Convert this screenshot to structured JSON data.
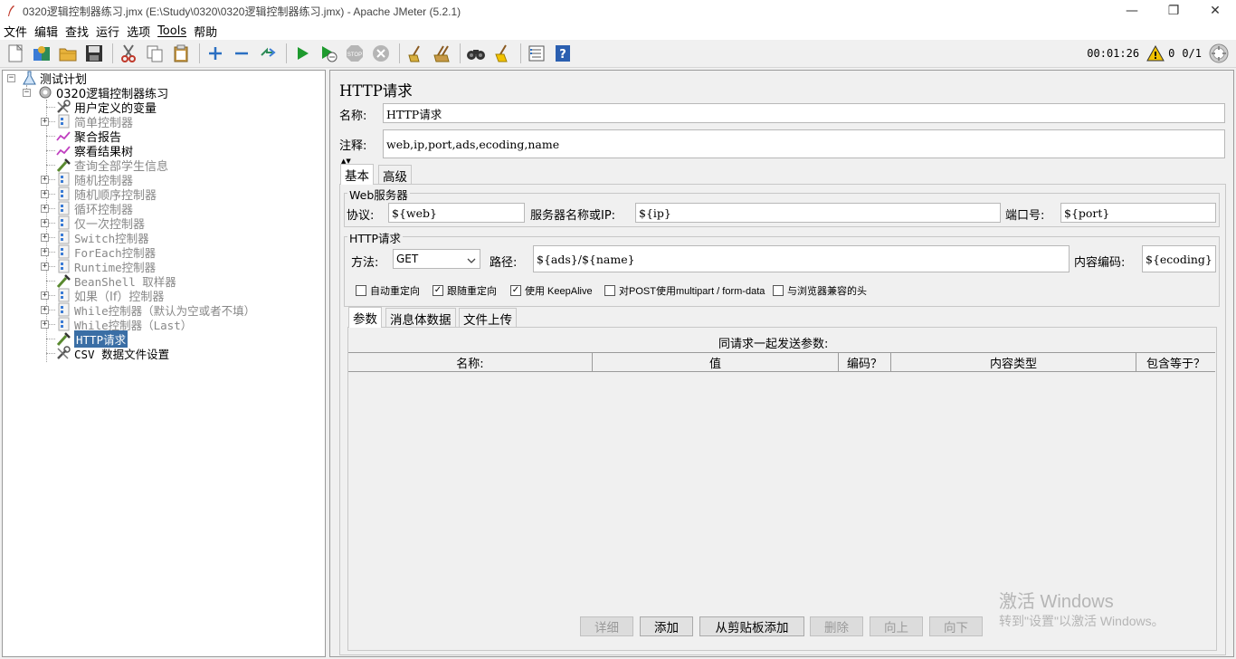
{
  "window": {
    "title": "0320逻辑控制器练习.jmx (E:\\Study\\0320\\0320逻辑控制器练习.jmx) - Apache JMeter (5.2.1)",
    "min_icon": "minimize-icon",
    "max_icon": "restore-icon",
    "close_icon": "close-icon"
  },
  "menu": [
    "文件",
    "编辑",
    "查找",
    "运行",
    "选项",
    "Tools",
    "帮助"
  ],
  "status": {
    "elapsed": "00:01:26",
    "warnings": "0",
    "threads": "0/1"
  },
  "tree": {
    "root": "测试计划",
    "plan": "0320逻辑控制器练习",
    "items": [
      {
        "label": "用户定义的变量",
        "icon": "wrench-icon",
        "expandable": false,
        "mono": false,
        "dim": false,
        "selected": false
      },
      {
        "label": "简单控制器",
        "icon": "controller-icon",
        "expandable": true,
        "mono": false,
        "dim": true,
        "selected": false
      },
      {
        "label": "聚合报告",
        "icon": "graph-icon",
        "expandable": false,
        "mono": false,
        "dim": false,
        "selected": false
      },
      {
        "label": "察看结果树",
        "icon": "graph-icon",
        "expandable": false,
        "mono": false,
        "dim": false,
        "selected": false
      },
      {
        "label": "查询全部学生信息",
        "icon": "pipette-icon",
        "expandable": false,
        "mono": false,
        "dim": true,
        "selected": false
      },
      {
        "label": "随机控制器",
        "icon": "controller-icon",
        "expandable": true,
        "mono": false,
        "dim": true,
        "selected": false
      },
      {
        "label": "随机顺序控制器",
        "icon": "controller-icon",
        "expandable": true,
        "mono": false,
        "dim": true,
        "selected": false
      },
      {
        "label": "循环控制器",
        "icon": "controller-icon",
        "expandable": true,
        "mono": false,
        "dim": true,
        "selected": false
      },
      {
        "label": "仅一次控制器",
        "icon": "controller-icon",
        "expandable": true,
        "mono": false,
        "dim": true,
        "selected": false
      },
      {
        "label": "Switch控制器",
        "icon": "controller-icon",
        "expandable": true,
        "mono": true,
        "dim": true,
        "selected": false
      },
      {
        "label": "ForEach控制器",
        "icon": "controller-icon",
        "expandable": true,
        "mono": true,
        "dim": true,
        "selected": false
      },
      {
        "label": "Runtime控制器",
        "icon": "controller-icon",
        "expandable": true,
        "mono": true,
        "dim": true,
        "selected": false
      },
      {
        "label": "BeanShell 取样器",
        "icon": "pipette-icon",
        "expandable": false,
        "mono": true,
        "dim": true,
        "selected": false
      },
      {
        "label": "如果（If）控制器",
        "icon": "controller-icon",
        "expandable": true,
        "mono": false,
        "dim": true,
        "selected": false
      },
      {
        "label": "While控制器（默认为空或者不填）",
        "icon": "controller-icon",
        "expandable": true,
        "mono": true,
        "dim": true,
        "selected": false
      },
      {
        "label": "While控制器（Last）",
        "icon": "controller-icon",
        "expandable": true,
        "mono": true,
        "dim": true,
        "selected": false
      },
      {
        "label": "HTTP请求",
        "icon": "pipette-icon",
        "expandable": false,
        "mono": true,
        "dim": false,
        "selected": true
      },
      {
        "label": "CSV 数据文件设置",
        "icon": "wrench-icon",
        "expandable": false,
        "mono": true,
        "dim": false,
        "selected": false
      }
    ]
  },
  "panel": {
    "heading": "HTTP请求",
    "name_label": "名称:",
    "name_value": "HTTP请求",
    "comment_label": "注释:",
    "comment_value": "web,ip,port,ads,ecoding,name",
    "tabs": [
      "基本",
      "高级"
    ],
    "web_server": {
      "title": "Web服务器",
      "protocol_label": "协议:",
      "protocol_value": "${web}",
      "server_label": "服务器名称或IP:",
      "server_value": "${ip}",
      "port_label": "端口号:",
      "port_value": "${port}"
    },
    "http_request": {
      "title": "HTTP请求",
      "method_label": "方法:",
      "method_value": "GET",
      "path_label": "路径:",
      "path_value": "${ads}/${name}",
      "encoding_label": "内容编码:",
      "encoding_value": "${ecoding}"
    },
    "checkboxes": [
      {
        "label": "自动重定向",
        "checked": false
      },
      {
        "label": "跟随重定向",
        "checked": true
      },
      {
        "label": "使用 KeepAlive",
        "checked": true
      },
      {
        "label": "对POST使用multipart / form-data",
        "checked": false
      },
      {
        "label": "与浏览器兼容的头",
        "checked": false
      }
    ],
    "inner_tabs": [
      "参数",
      "消息体数据",
      "文件上传"
    ],
    "params_caption": "同请求一起发送参数:",
    "columns": [
      "名称:",
      "值",
      "编码？",
      "内容类型",
      "包含等于？"
    ],
    "buttons": [
      {
        "label": "详细",
        "enabled": false
      },
      {
        "label": "添加",
        "enabled": true
      },
      {
        "label": "从剪贴板添加",
        "enabled": true
      },
      {
        "label": "删除",
        "enabled": false
      },
      {
        "label": "向上",
        "enabled": false
      },
      {
        "label": "向下",
        "enabled": false
      }
    ]
  },
  "watermark": {
    "line1": "激活 Windows",
    "line2": "转到\"设置\"以激活 Windows。"
  }
}
